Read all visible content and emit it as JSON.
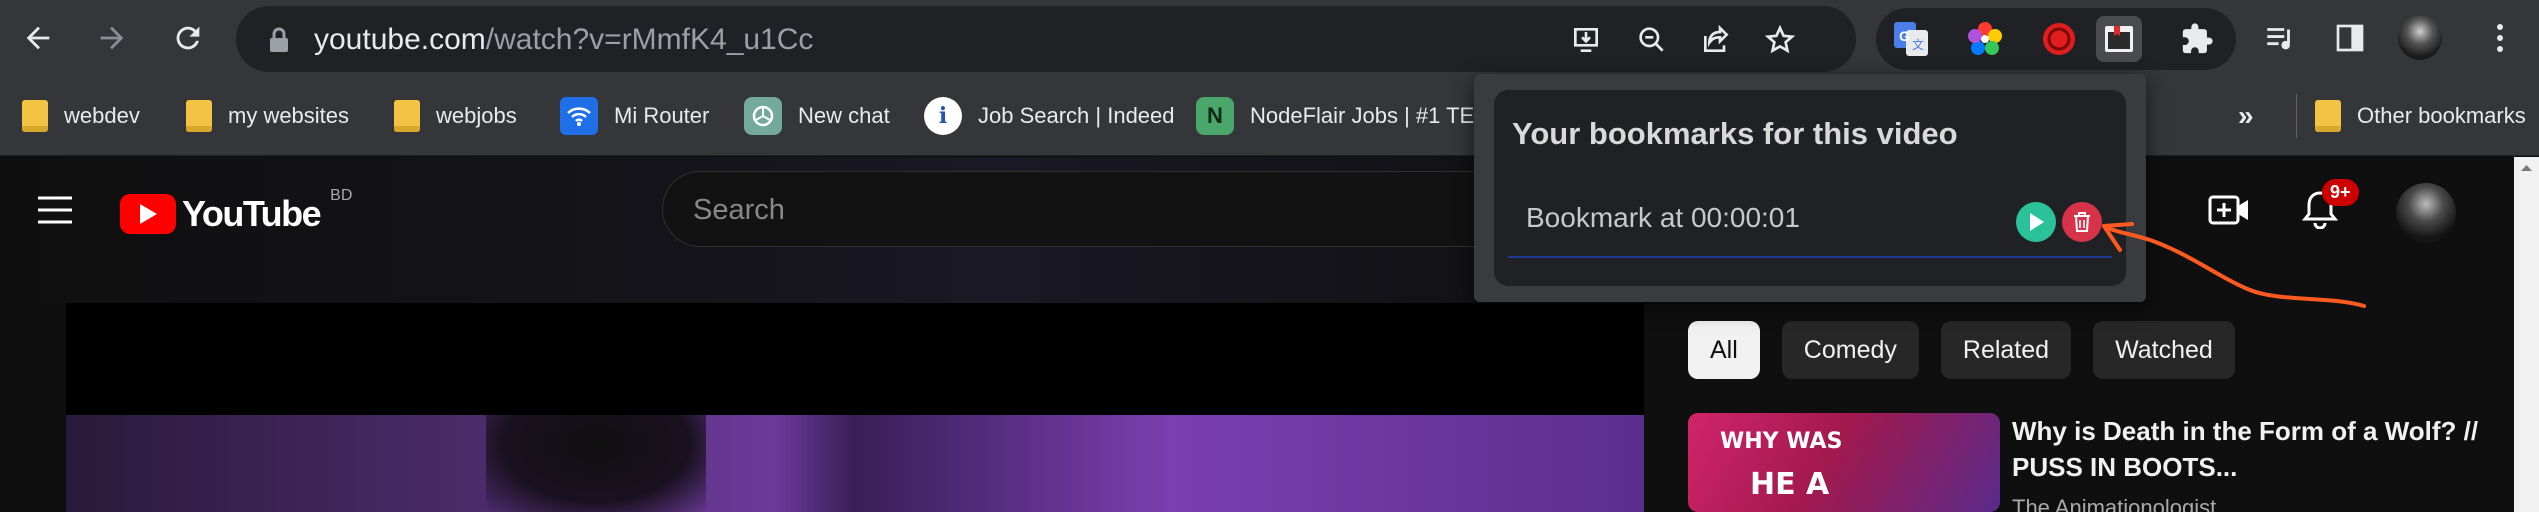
{
  "browser": {
    "url_host": "youtube.com",
    "url_path": "/watch?v=rMmfK4_u1Cc"
  },
  "bookmarks_bar": {
    "items": [
      {
        "label": "webdev",
        "icon": "folder-icon"
      },
      {
        "label": "my websites",
        "icon": "folder-icon"
      },
      {
        "label": "webjobs",
        "icon": "folder-icon"
      },
      {
        "label": "Mi Router",
        "icon": "wifi-icon"
      },
      {
        "label": "New chat",
        "icon": "chatgpt-icon"
      },
      {
        "label": "Job Search | Indeed",
        "icon": "info-icon"
      },
      {
        "label": "NodeFlair Jobs | #1 TECH",
        "icon": "nodeflair-icon"
      }
    ],
    "overflow": "»",
    "other_bookmarks": "Other bookmarks"
  },
  "youtube": {
    "logo_text": "YouTube",
    "country_code": "BD",
    "search_placeholder": "Search",
    "notification_count": "9+",
    "chips": [
      {
        "label": "All",
        "active": true
      },
      {
        "label": "Comedy",
        "active": false
      },
      {
        "label": "Related",
        "active": false
      },
      {
        "label": "Watched",
        "active": false
      }
    ],
    "recommendation": {
      "thumb_line1": "WHY WAS",
      "thumb_line2": "HE A",
      "title": "Why is Death in the Form of a Wolf? // PUSS IN BOOTS...",
      "channel": "The Animationologist"
    }
  },
  "popup": {
    "title": "Your bookmarks for this video",
    "bookmarks": [
      {
        "label": "Bookmark at 00:00:01"
      }
    ],
    "colors": {
      "play": "#2bc29a",
      "delete": "#d6334b",
      "annotation": "#ff5a1f"
    }
  }
}
